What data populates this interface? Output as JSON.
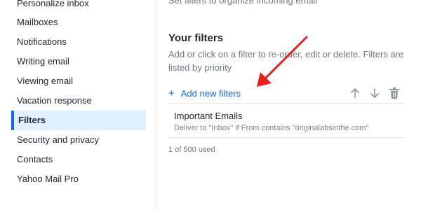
{
  "sidebar": {
    "items": [
      {
        "label": "Personalize inbox"
      },
      {
        "label": "Mailboxes"
      },
      {
        "label": "Notifications"
      },
      {
        "label": "Writing email"
      },
      {
        "label": "Viewing email"
      },
      {
        "label": "Vacation response"
      },
      {
        "label": "Filters"
      },
      {
        "label": "Security and privacy"
      },
      {
        "label": "Contacts"
      },
      {
        "label": "Yahoo Mail Pro"
      }
    ],
    "active_item": "Filters"
  },
  "main": {
    "top_description": "Set filters to organize incoming email",
    "section_title": "Your filters",
    "section_description": "Add or click on a filter to re-order, edit or delete. Filters are listed by priority",
    "add_filter_label": "Add new filters",
    "filters": [
      {
        "name": "Important Emails",
        "description": "Deliver to \"Inbox\" if From contains \"originalabsinthe.com\""
      }
    ],
    "usage": "1 of 500 used"
  },
  "icons": {
    "add": "plus-icon",
    "move_up": "arrow-up-icon",
    "move_down": "arrow-down-icon",
    "delete": "trash-icon"
  },
  "colors": {
    "accent": "#0f69ff",
    "active_bg": "#e0f0ff",
    "annotation_arrow": "#e8201c"
  }
}
